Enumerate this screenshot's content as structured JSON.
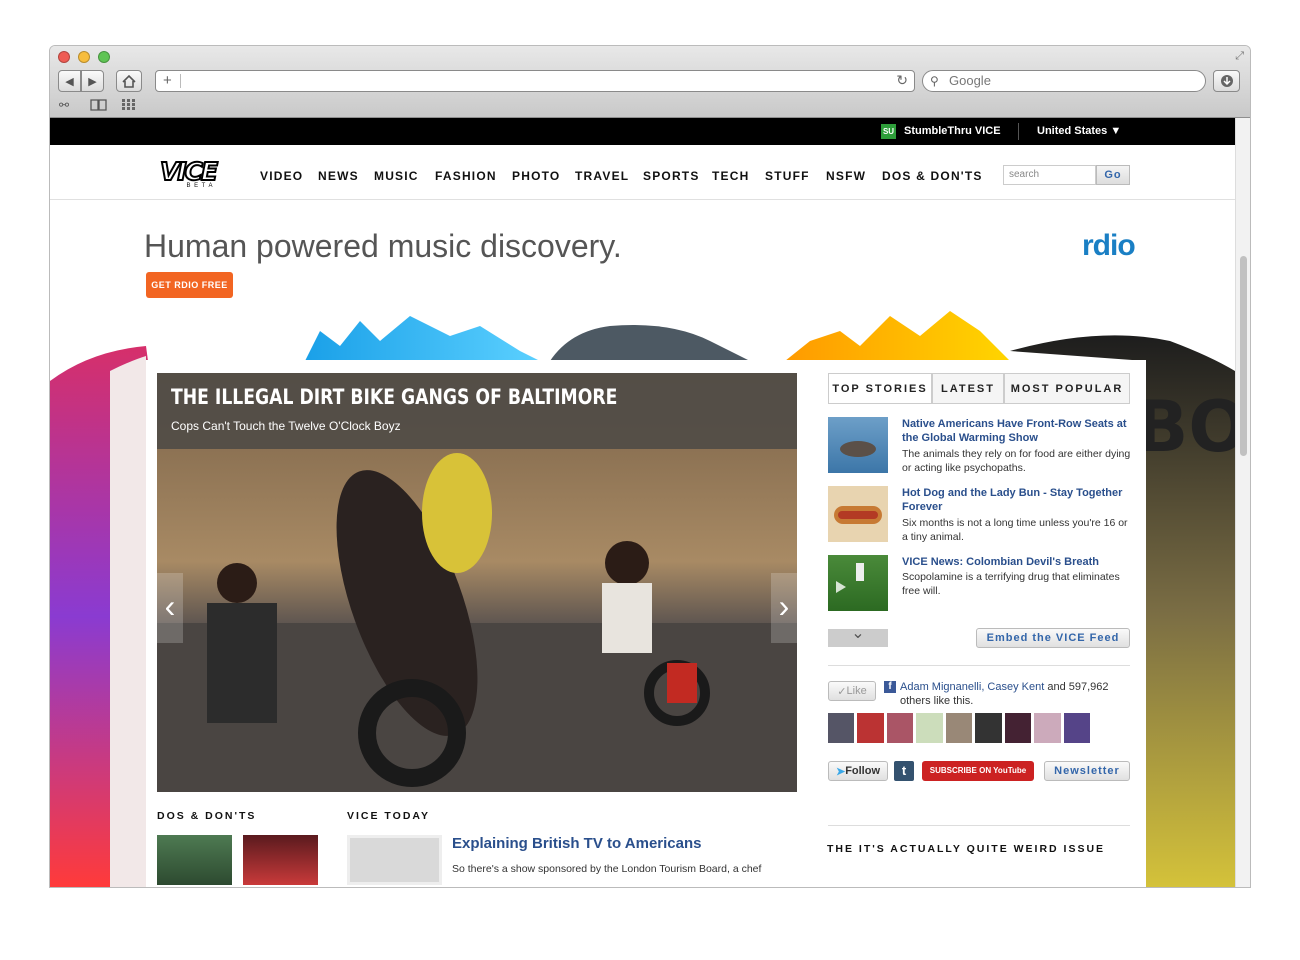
{
  "browser": {
    "search_placeholder": "Google",
    "add_tab_symbol": "+",
    "reload_symbol": "↻"
  },
  "topbar": {
    "stumble_icon": "SU",
    "stumble": "StumbleThru VICE",
    "region": "United States ▼"
  },
  "nav": {
    "logo": "VICE",
    "logo_sub": "B E T A",
    "links": [
      "VIDEO",
      "NEWS",
      "MUSIC",
      "FASHION",
      "PHOTO",
      "TRAVEL",
      "SPORTS",
      "TECH",
      "STUFF",
      "NSFW",
      "DOS & DON'TS"
    ],
    "search_placeholder": "search",
    "go": "Go"
  },
  "ad": {
    "headline": "Human powered music discovery.",
    "cta": "GET RDIO FREE",
    "brand": "rdio"
  },
  "featured": {
    "title": "THE ILLEGAL DIRT BIKE GANGS OF BALTIMORE",
    "subtitle": "Cops Can't Touch the Twelve O'Clock Boyz",
    "prev": "‹",
    "next": "›"
  },
  "sidebar": {
    "tabs": [
      "TOP STORIES",
      "LATEST",
      "MOST POPULAR"
    ],
    "stories": [
      {
        "title": "Native Americans Have Front-Row Seats at the Global Warming Show",
        "desc": "The animals they rely on for food are either dying or acting like psychopaths."
      },
      {
        "title": "Hot Dog and the Lady Bun - Stay Together Forever",
        "desc": "Six months is not a long time unless you're 16 or a tiny animal."
      },
      {
        "title": "VICE News: Colombian Devil's Breath",
        "desc": "Scopolamine is a terrifying drug that eliminates free will."
      }
    ],
    "more_symbol": "⌄",
    "embed": "Embed the VICE Feed",
    "like_label": "Like",
    "like_people": "Adam Mignanelli, Casey Kent",
    "like_rest": " and 597,962 others like this.",
    "follow": "Follow",
    "tumblr": "t",
    "youtube": "SUBSCRIBE ON YouTube",
    "newsletter": "Newsletter",
    "issue_heading": "THE IT'S ACTUALLY QUITE WEIRD ISSUE"
  },
  "bottom": {
    "dos_heading": "DOS & DON'TS",
    "today_heading": "VICE TODAY",
    "today_title": "Explaining British TV to Americans",
    "today_desc": "So there's a show sponsored by the London Tourism Board, a chef"
  },
  "colors": {
    "link": "#2a4f8c",
    "rdio_blue": "#1a7fc4",
    "cta_orange": "#f26522"
  }
}
